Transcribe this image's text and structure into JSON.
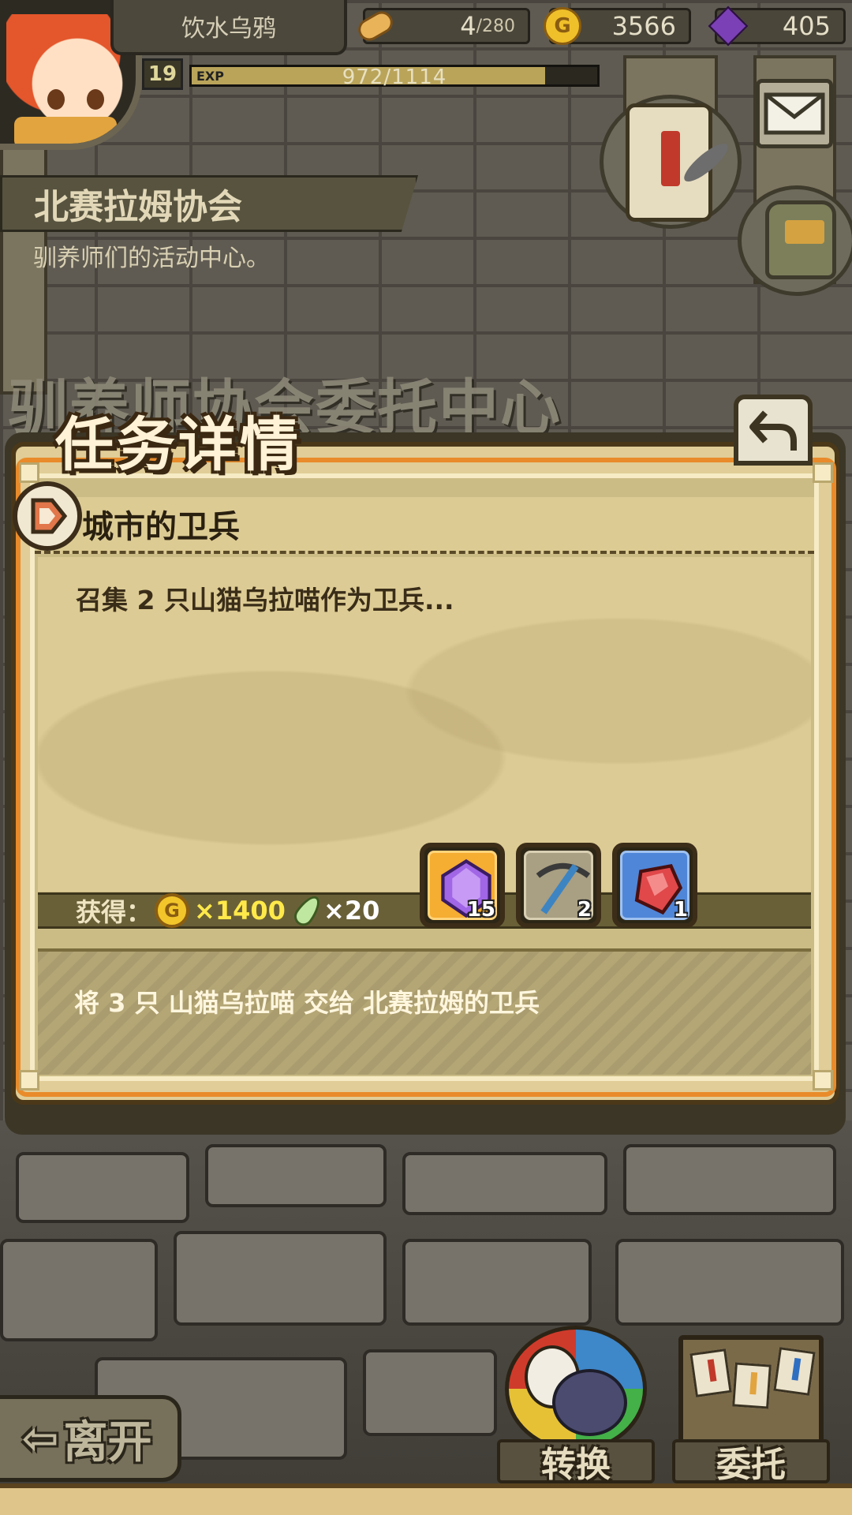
{
  "player": {
    "name": "饮水乌鸦",
    "level": "19",
    "exp_label": "EXP",
    "exp_text": "972/1114",
    "exp_fraction": 0.8725
  },
  "resources": {
    "stamina_current": "4",
    "stamina_max": "/280",
    "gold": "3566",
    "gems": "405",
    "gold_icon_letter": "G"
  },
  "location": {
    "name": "北赛拉姆协会",
    "subtitle": "驯养师们的活动中心。"
  },
  "background_title": "驯养师协会委托中心",
  "dialog": {
    "title": "任务详情",
    "quest_name": "城市的卫兵",
    "description": "召集 2 只山猫乌拉喵作为卫兵...",
    "reward_label": "获得：",
    "reward_gold": "×1400",
    "reward_feather": "×20",
    "items": [
      {
        "icon": "purple-crystal-icon",
        "count": "15",
        "frame": "gold"
      },
      {
        "icon": "pickaxe-icon",
        "count": "2",
        "frame": "plain"
      },
      {
        "icon": "red-ore-icon",
        "count": "1",
        "frame": "blue"
      }
    ],
    "requirement": "将 3 只 山猫乌拉喵 交给 北赛拉姆的卫兵"
  },
  "buttons": {
    "leave": "离开",
    "convert": "转换",
    "commission": "委托"
  },
  "colors": {
    "dialog_orange": "#e98b2a",
    "parchment": "#dccb94",
    "gold_text": "#ffe94a"
  }
}
